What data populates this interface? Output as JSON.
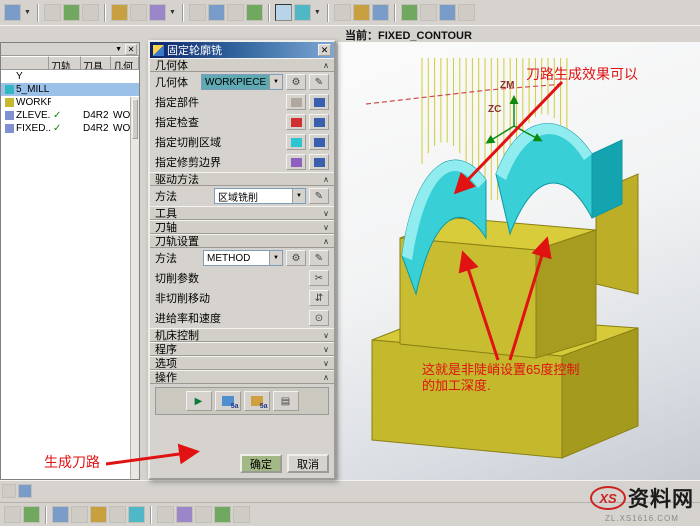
{
  "glyphs": {
    "close": "✕",
    "dropdown": "▼",
    "chevron_up": "∧",
    "chevron_down": "∨",
    "check": "✓",
    "play": "▶",
    "edit": "✎",
    "gear": "⚙",
    "scissors": "✂",
    "moves": "⇵",
    "speed": "⊙",
    "list": "▤"
  },
  "top": {
    "current": "当前：FIXED_CONTOUR"
  },
  "navigator": {
    "columns": {
      "c1": "刀轨",
      "c2": "刀具",
      "c3": "几何"
    },
    "rows": [
      {
        "name": "Y",
        "check": "",
        "tool": "",
        "geom": ""
      },
      {
        "name": "5_MILL",
        "check": "",
        "tool": "",
        "geom": ""
      },
      {
        "name": "WORKPIECE",
        "check": "",
        "tool": "",
        "geom": ""
      },
      {
        "name": "ZLEVE...",
        "check": "✓",
        "tool": "D4R2",
        "geom": "WOR..."
      },
      {
        "name": "FIXED...",
        "check": "✓",
        "tool": "D4R2",
        "geom": "WOR..."
      }
    ]
  },
  "dialog": {
    "title": "固定轮廓铣",
    "geometry_section": "几何体",
    "geometry_label": "几何体",
    "geometry_value": "WORKPIECE",
    "specify_part": "指定部件",
    "specify_check": "指定检查",
    "specify_cut_area": "指定切削区域",
    "specify_trim": "指定修剪边界",
    "drive_section": "驱动方法",
    "method_label": "方法",
    "drive_method_value": "区域铣削",
    "tool_section": "工具",
    "axis_section": "刀轴",
    "path_section": "刀轨设置",
    "path_method_value": "METHOD",
    "cutting_params": "切削参数",
    "noncutting_moves": "非切削移动",
    "feeds_speeds": "进给率和速度",
    "machine_section": "机床控制",
    "program_section": "程序",
    "options_section": "选项",
    "actions_section": "操作",
    "action_badge": "5a",
    "ok": "确定",
    "cancel": "取消"
  },
  "annotations": {
    "effect": "刀路生成效果可以",
    "depth1": "这就是非陡峭设置65度控制",
    "depth2": "的加工深度.",
    "generate": "生成刀路",
    "zm": "ZM",
    "zc": "ZC"
  },
  "watermark": {
    "logo": "XS",
    "name": "资料网",
    "site": "ZL.XS1616.COM"
  },
  "colors": {
    "accent_red": "#e01212",
    "model_yellow": "#c4b82c",
    "model_cyan": "#38d0d6",
    "selection_blue": "#9cc1e8"
  }
}
